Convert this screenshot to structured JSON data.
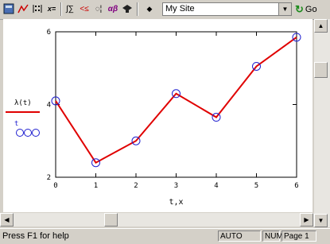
{
  "toolbar": {
    "icons": [
      "calculator-icon",
      "graph-icon",
      "matrix-icon",
      "evaluation-icon",
      "calculus-icon",
      "boolean-icon",
      "programming-icon",
      "greek-icon",
      "symbolic-icon",
      "resource-center-icon"
    ],
    "site_select_value": "My Site",
    "go_label": "Go"
  },
  "legend": {
    "trace1": "λ(t)",
    "trace2": "t"
  },
  "chart_data": {
    "type": "line",
    "x": [
      0,
      1,
      2,
      3,
      4,
      5,
      6
    ],
    "series": [
      {
        "name": "λ(t)",
        "values": [
          4.1,
          2.4,
          3.0,
          4.3,
          3.65,
          5.05,
          5.85
        ],
        "color": "#e00000"
      }
    ],
    "xlabel": "t,x",
    "xlim": [
      0,
      6
    ],
    "ylim": [
      2,
      6
    ],
    "xticks": [
      "0",
      "1",
      "2",
      "3",
      "4",
      "5",
      "6"
    ],
    "yticks": [
      "2",
      "4",
      "6"
    ],
    "marker_color": "#2020d0"
  },
  "status": {
    "message": "Press F1 for help",
    "mode": "AUTO",
    "num": "NUM",
    "page": "Page 1"
  }
}
